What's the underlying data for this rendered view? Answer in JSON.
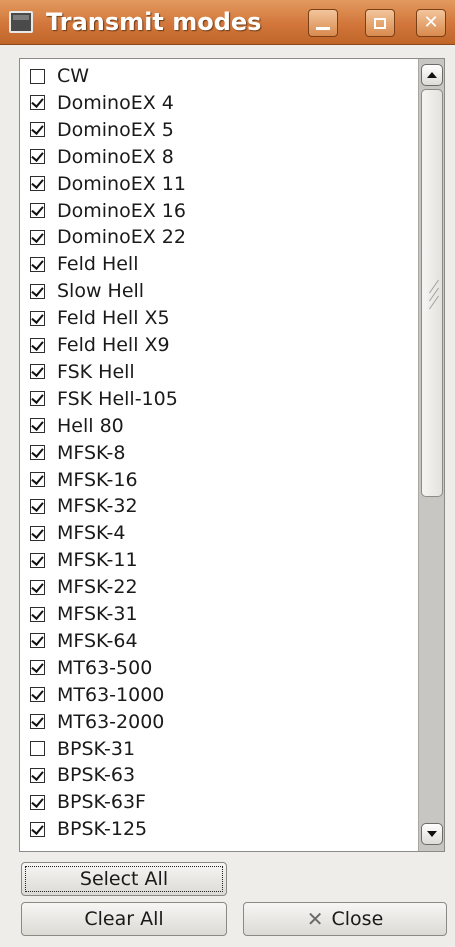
{
  "window": {
    "title": "Transmit modes",
    "colors": {
      "titlebar": "#d2763b",
      "background": "#efedea"
    }
  },
  "titlebar_buttons": {
    "minimize": "minimize-icon",
    "maximize": "maximize-icon",
    "close": "close-icon"
  },
  "modes": [
    {
      "label": "CW",
      "checked": false
    },
    {
      "label": "DominoEX 4",
      "checked": true
    },
    {
      "label": "DominoEX 5",
      "checked": true
    },
    {
      "label": "DominoEX 8",
      "checked": true
    },
    {
      "label": "DominoEX 11",
      "checked": true
    },
    {
      "label": "DominoEX 16",
      "checked": true
    },
    {
      "label": "DominoEX 22",
      "checked": true
    },
    {
      "label": "Feld Hell",
      "checked": true
    },
    {
      "label": "Slow Hell",
      "checked": true
    },
    {
      "label": "Feld Hell X5",
      "checked": true
    },
    {
      "label": "Feld Hell X9",
      "checked": true
    },
    {
      "label": "FSK Hell",
      "checked": true
    },
    {
      "label": "FSK Hell-105",
      "checked": true
    },
    {
      "label": "Hell 80",
      "checked": true
    },
    {
      "label": "MFSK-8",
      "checked": true
    },
    {
      "label": "MFSK-16",
      "checked": true
    },
    {
      "label": "MFSK-32",
      "checked": true
    },
    {
      "label": "MFSK-4",
      "checked": true
    },
    {
      "label": "MFSK-11",
      "checked": true
    },
    {
      "label": "MFSK-22",
      "checked": true
    },
    {
      "label": "MFSK-31",
      "checked": true
    },
    {
      "label": "MFSK-64",
      "checked": true
    },
    {
      "label": "MT63-500",
      "checked": true
    },
    {
      "label": "MT63-1000",
      "checked": true
    },
    {
      "label": "MT63-2000",
      "checked": true
    },
    {
      "label": "BPSK-31",
      "checked": false
    },
    {
      "label": "BPSK-63",
      "checked": true
    },
    {
      "label": "BPSK-63F",
      "checked": true
    },
    {
      "label": "BPSK-125",
      "checked": true
    }
  ],
  "scrollbar": {
    "position": 0,
    "visible_fraction": 0.52
  },
  "buttons": {
    "select_all": "Select All",
    "clear_all": "Clear All",
    "close": "Close",
    "close_icon": "x-icon"
  }
}
